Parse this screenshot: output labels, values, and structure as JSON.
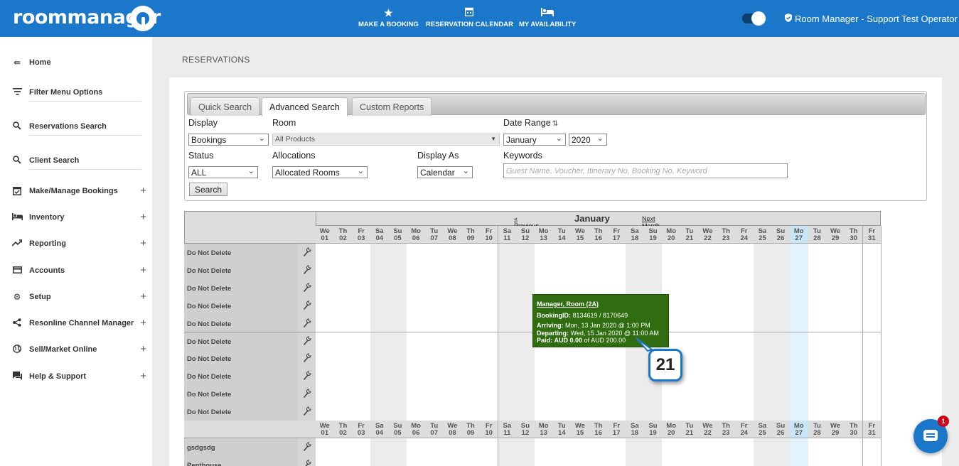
{
  "header": {
    "logo_text": "roommanager",
    "nav": [
      {
        "label": "MAKE A BOOKING",
        "icon": "star-icon"
      },
      {
        "label": "RESERVATION CALENDAR",
        "icon": "calendar-icon"
      },
      {
        "label": "MY AVAILABILITY",
        "icon": "bed-icon"
      }
    ],
    "user_label": "Room Manager - Support Test Operator"
  },
  "sidebar": {
    "items": [
      {
        "label": "Home",
        "icon": "back-arrow-icon",
        "expandable": false
      },
      {
        "label": "Filter Menu Options",
        "icon": "filter-icon",
        "expandable": false
      },
      {
        "label": "Reservations Search",
        "icon": "search-icon",
        "expandable": false
      },
      {
        "label": "Client Search",
        "icon": "search-icon",
        "expandable": false
      },
      {
        "label": "Make/Manage Bookings",
        "icon": "calendar-check-icon",
        "expandable": true
      },
      {
        "label": "Inventory",
        "icon": "bed-icon",
        "expandable": true
      },
      {
        "label": "Reporting",
        "icon": "trending-icon",
        "expandable": true
      },
      {
        "label": "Accounts",
        "icon": "credit-card-icon",
        "expandable": true
      },
      {
        "label": "Setup",
        "icon": "gear-icon",
        "expandable": true
      },
      {
        "label": "Resonline Channel Manager",
        "icon": "share-icon",
        "expandable": true
      },
      {
        "label": "Sell/Market Online",
        "icon": "globe-icon",
        "expandable": true
      },
      {
        "label": "Help & Support",
        "icon": "chat-icon",
        "expandable": true
      }
    ],
    "plus": "+"
  },
  "page_title": "RESERVATIONS",
  "search": {
    "tabs": [
      "Quick Search",
      "Advanced Search",
      "Custom Reports"
    ],
    "active_tab": "Advanced Search",
    "labels": {
      "display": "Display",
      "room": "Room",
      "date_range": "Date Range",
      "status": "Status",
      "allocations": "Allocations",
      "display_as": "Display As",
      "keywords": "Keywords"
    },
    "values": {
      "display": "Bookings",
      "room": "All Products",
      "month": "January",
      "year": "2020",
      "status": "ALL",
      "allocations": "Allocated Rooms",
      "display_as": "Calendar"
    },
    "keywords_placeholder": "Guest Name, Voucher, Itinerary No, Booking No, Keyword",
    "search_button": "Search"
  },
  "calendar": {
    "title": "January 2020",
    "prev": "« Previous Month",
    "next": "Next Month »",
    "days": [
      {
        "d": "We",
        "n": "01"
      },
      {
        "d": "Th",
        "n": "02"
      },
      {
        "d": "Fr",
        "n": "03"
      },
      {
        "d": "Sa",
        "n": "04"
      },
      {
        "d": "Su",
        "n": "05"
      },
      {
        "d": "Mo",
        "n": "06"
      },
      {
        "d": "Tu",
        "n": "07"
      },
      {
        "d": "We",
        "n": "08"
      },
      {
        "d": "Th",
        "n": "09"
      },
      {
        "d": "Fr",
        "n": "10"
      },
      {
        "d": "Sa",
        "n": "11"
      },
      {
        "d": "Su",
        "n": "12"
      },
      {
        "d": "Mo",
        "n": "13"
      },
      {
        "d": "Tu",
        "n": "14"
      },
      {
        "d": "We",
        "n": "15"
      },
      {
        "d": "Th",
        "n": "16"
      },
      {
        "d": "Fr",
        "n": "17"
      },
      {
        "d": "Sa",
        "n": "18"
      },
      {
        "d": "Su",
        "n": "19"
      },
      {
        "d": "Mo",
        "n": "20"
      },
      {
        "d": "Tu",
        "n": "21"
      },
      {
        "d": "We",
        "n": "22"
      },
      {
        "d": "Th",
        "n": "23"
      },
      {
        "d": "Fr",
        "n": "24"
      },
      {
        "d": "Sa",
        "n": "25"
      },
      {
        "d": "Su",
        "n": "26"
      },
      {
        "d": "Mo",
        "n": "27"
      },
      {
        "d": "Tu",
        "n": "28"
      },
      {
        "d": "We",
        "n": "29"
      },
      {
        "d": "Th",
        "n": "30"
      },
      {
        "d": "Fr",
        "n": "31"
      }
    ],
    "today": "27",
    "rooms_group1": [
      "Do Not Delete",
      "Do Not Delete",
      "Do Not Delete",
      "Do Not Delete",
      "Do Not Delete",
      "Do Not Delete",
      "Do Not Delete",
      "Do Not Delete",
      "Do Not Delete",
      "Do Not Delete"
    ],
    "rooms_group2": [
      "gsdgsdg",
      "Penthouse"
    ]
  },
  "tooltip": {
    "title": "Manager, Room (2A)",
    "booking_label": "BookingID:",
    "booking_value": "8134619 / 8170649",
    "arriving_label": "Arriving:",
    "arriving_value": "Mon, 13 Jan 2020 @ 1:00 PM",
    "departing_label": "Departing:",
    "departing_value": "Wed, 15 Jan 2020 @ 11:00 AM",
    "paid_label": "Paid:",
    "paid_amount": "AUD 0.00",
    "paid_of": "of AUD 200.00"
  },
  "callout_number": "21",
  "chat": {
    "notifications": "1"
  }
}
